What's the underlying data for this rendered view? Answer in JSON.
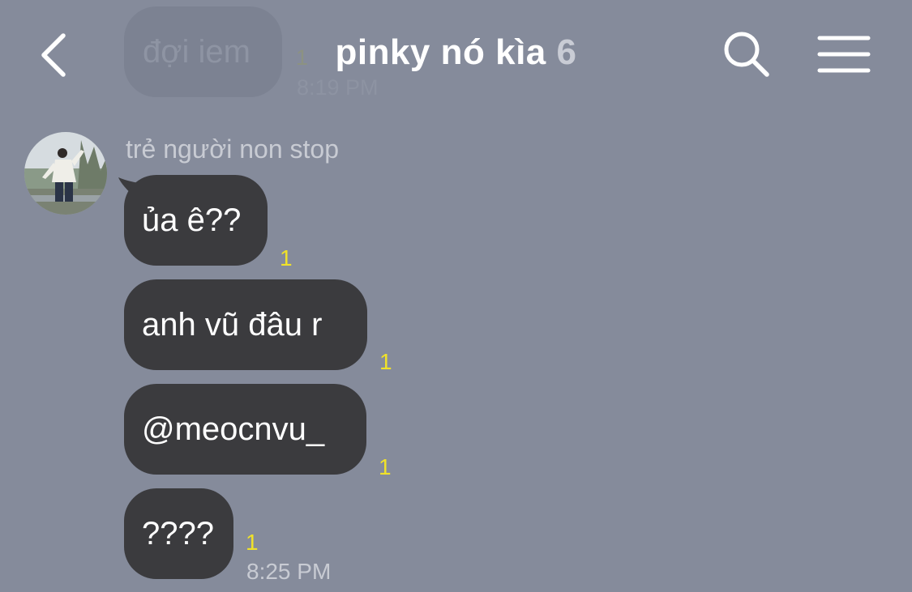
{
  "previous_message": {
    "text": "đợi iem",
    "read_count": "1",
    "time": "8:19 PM"
  },
  "header": {
    "title": "pinky nó kìa",
    "member_count": "6"
  },
  "sender": {
    "name": "trẻ người non stop"
  },
  "messages": [
    {
      "text": "ủa ê??",
      "read_count": "1"
    },
    {
      "text": "anh vũ đâu r",
      "read_count": "1"
    },
    {
      "text": "@meocnvu_",
      "read_count": "1"
    },
    {
      "text": "????",
      "read_count": "1",
      "time": "8:25 PM"
    }
  ],
  "colors": {
    "background": "#858b9b",
    "bubble": "#3b3b3e",
    "read_count": "#f0e229"
  },
  "icons": {
    "back": "back-arrow-icon",
    "search": "search-icon",
    "menu": "hamburger-menu-icon"
  }
}
